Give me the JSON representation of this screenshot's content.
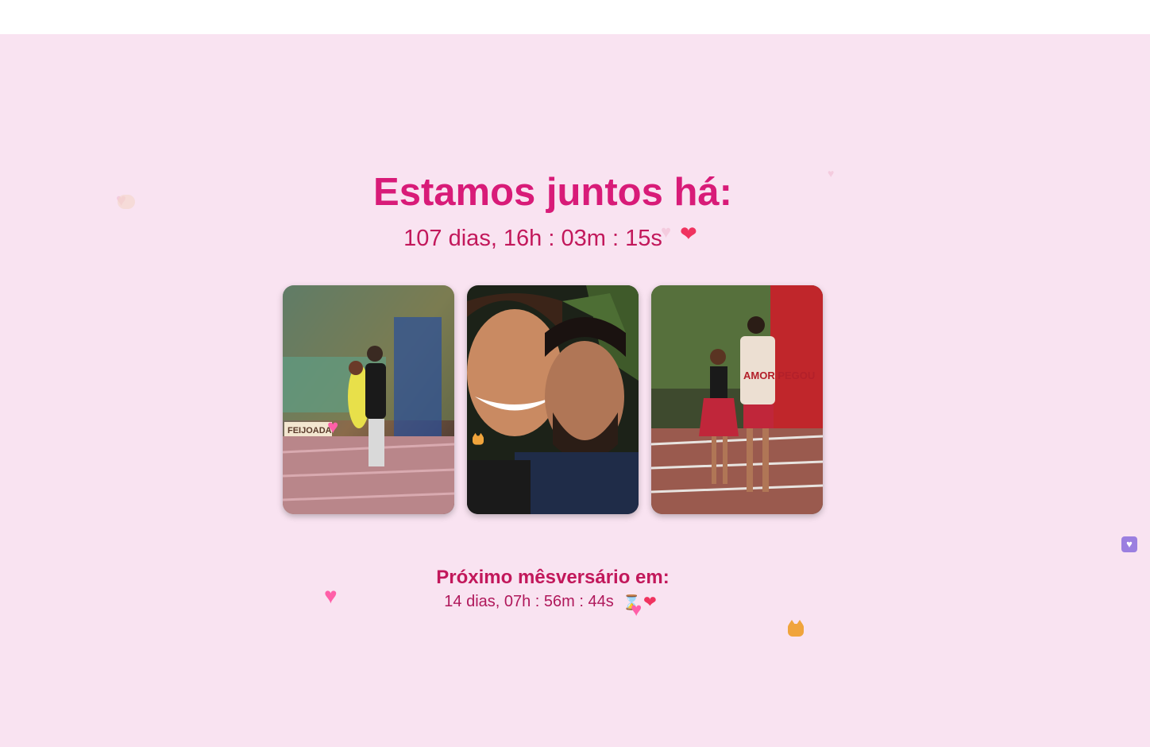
{
  "header": {
    "title": "Estamos juntos há:",
    "counter": "107 dias, 16h : 03m : 15s"
  },
  "photos": [
    {
      "alt": "casal em frente ao mural"
    },
    {
      "alt": "selfie do casal"
    },
    {
      "alt": "casal com camiseta AMOR PEGOU"
    }
  ],
  "photo3_shirt_text": "AMOR PEGOU",
  "photo1_mural_text": "FEIJOADA",
  "next": {
    "title": "Próximo mêsversário em:",
    "counter": "14 dias, 07h : 56m : 44s"
  },
  "decorations": {
    "heart_icon": "heart-icon",
    "hourglass_icon": "hourglass-icon",
    "cat_icon": "cat-heart-icon"
  },
  "colors": {
    "background": "#f9e3f1",
    "title": "#d81b78",
    "counter": "#c2185b"
  }
}
